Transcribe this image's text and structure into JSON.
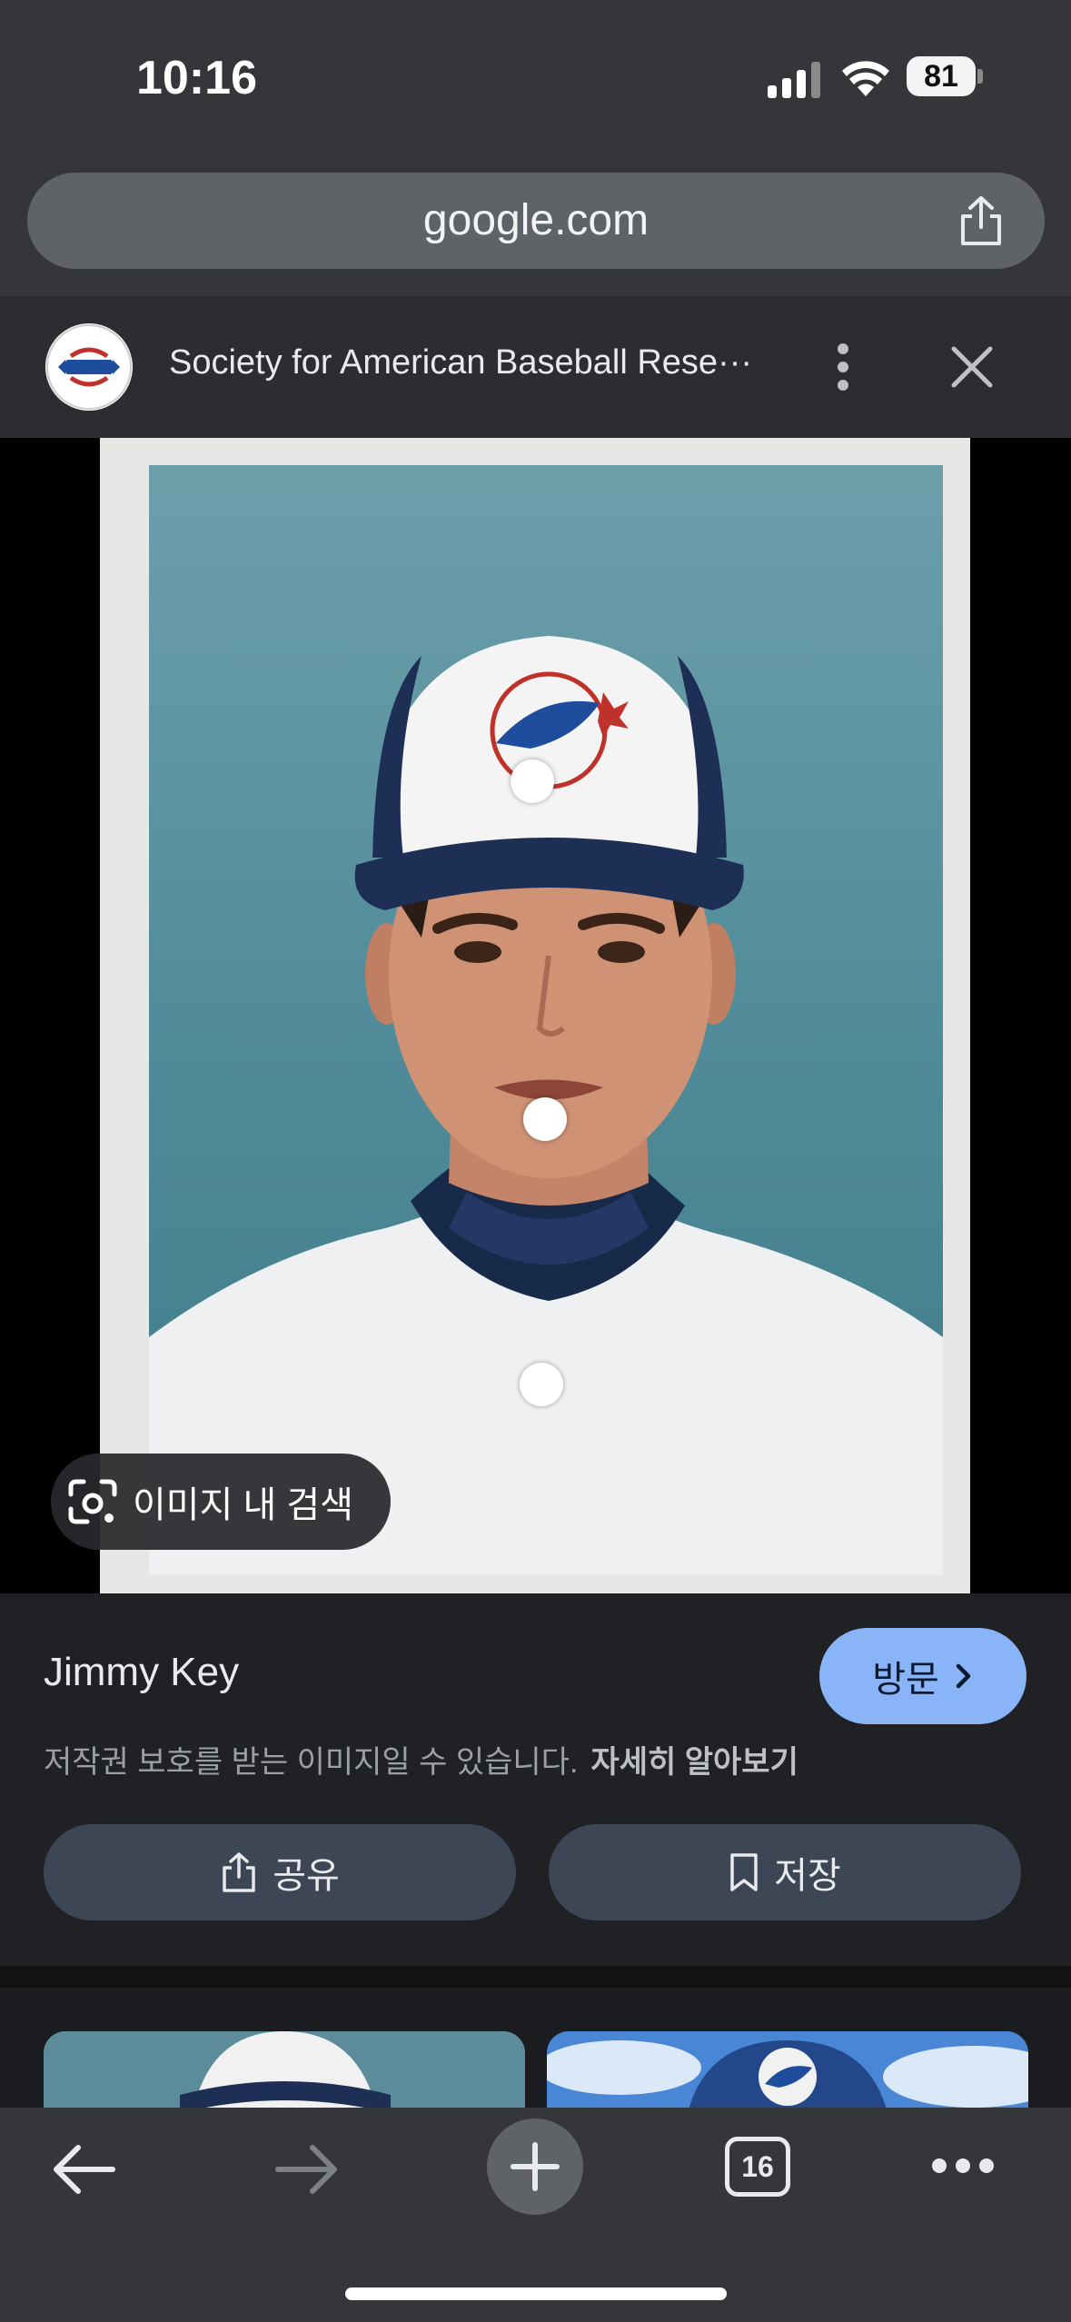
{
  "status_bar": {
    "time": "10:16",
    "battery": "81"
  },
  "browser": {
    "url": "google.com"
  },
  "source": {
    "name": "Society for American Baseball Rese···"
  },
  "image": {
    "lens_label": "이미지 내 검색"
  },
  "result": {
    "title": "Jimmy Key",
    "visit_label": "방문",
    "copyright_notice": "저작권 보호를 받는 이미지일 수 있습니다.",
    "learn_more": "자세히 알아보기",
    "share_label": "공유",
    "save_label": "저장"
  },
  "toolbar": {
    "tab_count": "16"
  },
  "colors": {
    "accent": "#8ab4f8",
    "button": "#3c4655",
    "chrome": "#35363a",
    "background": "#202124"
  }
}
